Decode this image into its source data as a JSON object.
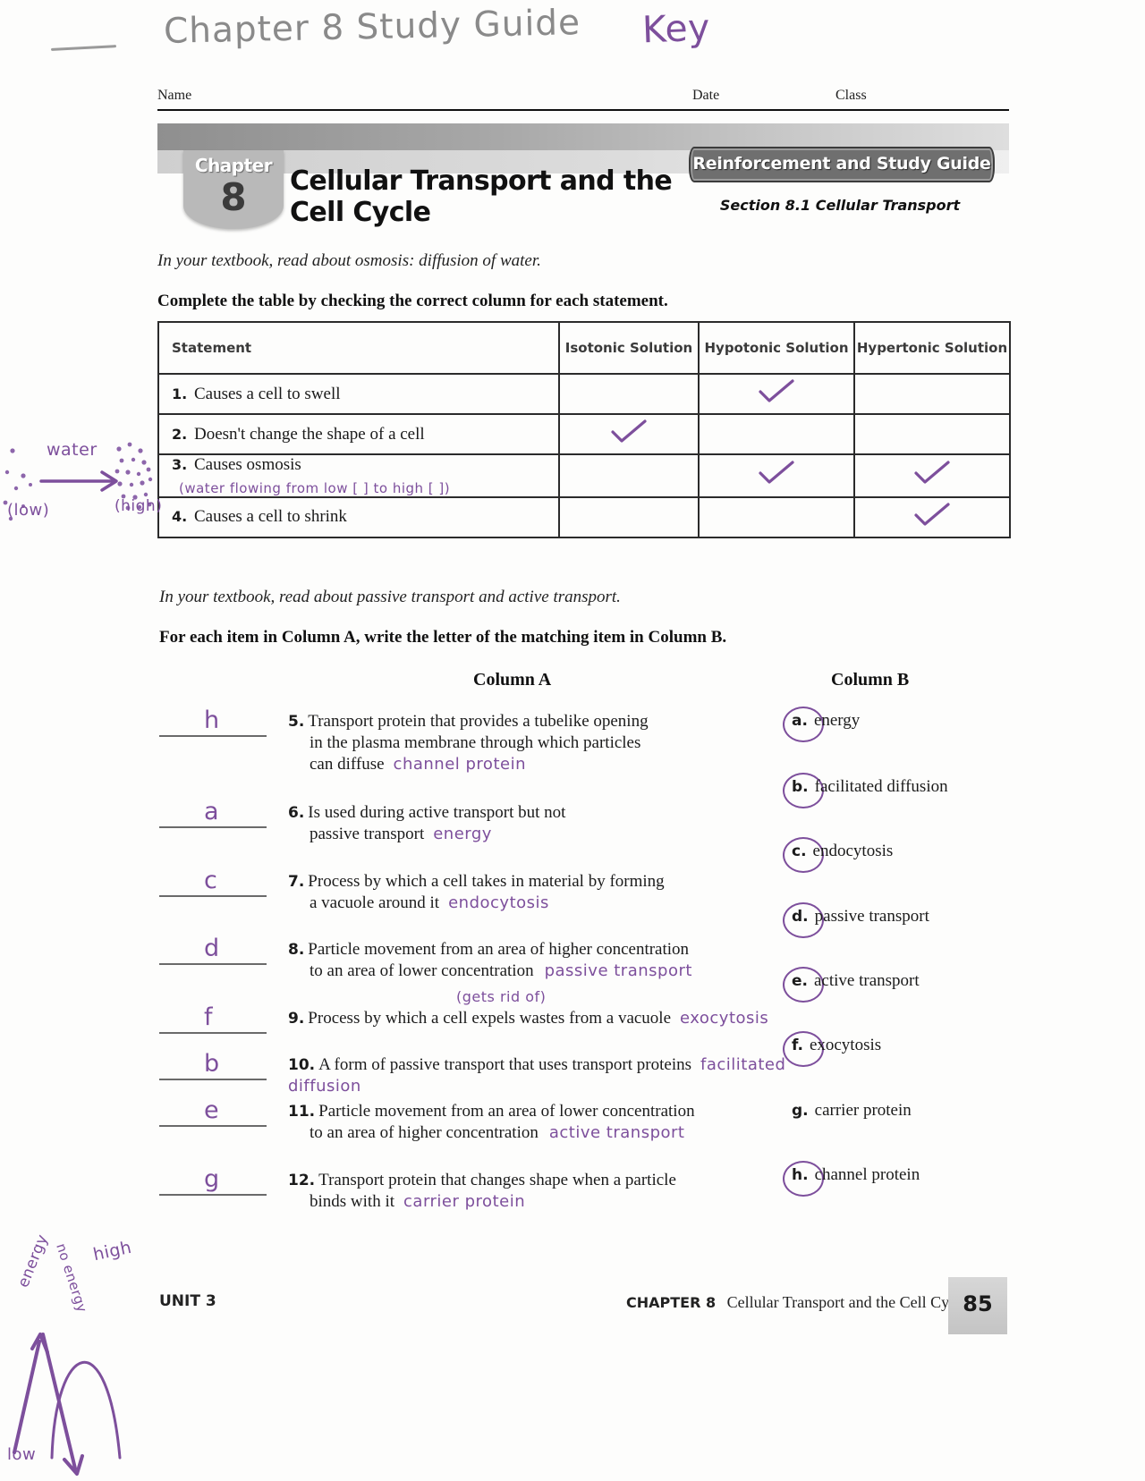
{
  "handwritten_header": {
    "title": "Chapter 8 Study Guide",
    "key": "Key"
  },
  "id_line": {
    "name": "Name",
    "date": "Date",
    "class": "Class"
  },
  "header": {
    "chapter_word": "Chapter",
    "chapter_number": "8",
    "title": "Cellular Transport and the Cell Cycle",
    "guide_label": "Reinforcement and Study Guide",
    "section_label": "Section 8.1  Cellular Transport"
  },
  "section1": {
    "read_instruction": "In your textbook, read about osmosis: diffusion of water.",
    "task_instruction": "Complete the table by checking the correct column for each statement.",
    "table": {
      "headers": [
        "Statement",
        "Isotonic Solution",
        "Hypotonic Solution",
        "Hypertonic Solution"
      ],
      "rows": [
        {
          "num": "1.",
          "text": "Causes a cell to swell",
          "annotation": "",
          "checks": [
            false,
            true,
            false
          ]
        },
        {
          "num": "2.",
          "text": "Doesn't change the shape of a cell",
          "annotation": "",
          "checks": [
            true,
            false,
            false
          ]
        },
        {
          "num": "3.",
          "text": "Causes osmosis",
          "annotation": "(water flowing from low [ ] to high [ ])",
          "checks": [
            false,
            true,
            true
          ]
        },
        {
          "num": "4.",
          "text": "Causes a cell to shrink",
          "annotation": "",
          "checks": [
            false,
            false,
            true
          ]
        }
      ]
    },
    "margin_doodle": {
      "water_label": "water",
      "low_label": "(low)",
      "high_label": "(high)"
    }
  },
  "section2": {
    "read_instruction": "In your textbook, read about passive transport and active transport.",
    "task_instruction": "For each item in Column A, write the letter of the matching item in Column B.",
    "column_a_header": "Column A",
    "column_b_header": "Column B",
    "column_a": [
      {
        "num": "5.",
        "answer": "h",
        "line1": "Transport protein that provides a tubelike opening",
        "line2": "in the plasma membrane through which particles",
        "line3": "can diffuse",
        "handwritten": "channel protein"
      },
      {
        "num": "6.",
        "answer": "a",
        "line1": "Is used during active transport but not",
        "line2": "passive transport",
        "line3": "",
        "handwritten": "energy"
      },
      {
        "num": "7.",
        "answer": "c",
        "line1": "Process by which a cell takes in material by forming",
        "line2": "a vacuole around it",
        "line3": "",
        "handwritten": "endocytosis"
      },
      {
        "num": "8.",
        "answer": "d",
        "line1": "Particle movement from an area of higher concentration",
        "line2": "to an area of lower concentration",
        "line3": "",
        "handwritten": "passive transport"
      },
      {
        "num": "9.",
        "answer": "f",
        "line1": "Process by which a cell expels wastes from a vacuole",
        "line2": "",
        "line3": "",
        "handwritten": "exocytosis",
        "handwritten_above": "(gets rid of)"
      },
      {
        "num": "10.",
        "answer": "b",
        "line1": "A form of passive transport that uses transport proteins",
        "line2": "",
        "line3": "",
        "handwritten": "facilitated diffusion"
      },
      {
        "num": "11.",
        "answer": "e",
        "line1": "Particle movement from an area of lower concentration",
        "line2": "to an area of higher concentration",
        "line3": "",
        "handwritten": "active transport"
      },
      {
        "num": "12.",
        "answer": "g",
        "line1": "Transport protein that changes shape when a particle",
        "line2": "binds with it",
        "line3": "",
        "handwritten": "carrier protein"
      }
    ],
    "column_b": [
      {
        "letter": "a.",
        "text": "energy",
        "circled": true
      },
      {
        "letter": "b.",
        "text": "facilitated diffusion",
        "circled": true
      },
      {
        "letter": "c.",
        "text": "endocytosis",
        "circled": true
      },
      {
        "letter": "d.",
        "text": "passive transport",
        "circled": true
      },
      {
        "letter": "e.",
        "text": "active transport",
        "circled": true
      },
      {
        "letter": "f.",
        "text": "exocytosis",
        "circled": true
      },
      {
        "letter": "g.",
        "text": "carrier protein",
        "circled": false
      },
      {
        "letter": "h.",
        "text": "channel protein",
        "circled": true
      }
    ]
  },
  "energy_sketch": {
    "high_label": "high",
    "low_label": "low",
    "energy_label": "energy",
    "no_energy_label": "no energy"
  },
  "footer": {
    "unit": "UNIT 3",
    "chapter_prefix": "CHAPTER 8",
    "chapter_title": "Cellular Transport and the Cell Cycle",
    "page_number": "85"
  },
  "colors": {
    "ink": "#7d4f9c",
    "pencil": "#8a8a8a",
    "rule": "#2b2b2b"
  }
}
